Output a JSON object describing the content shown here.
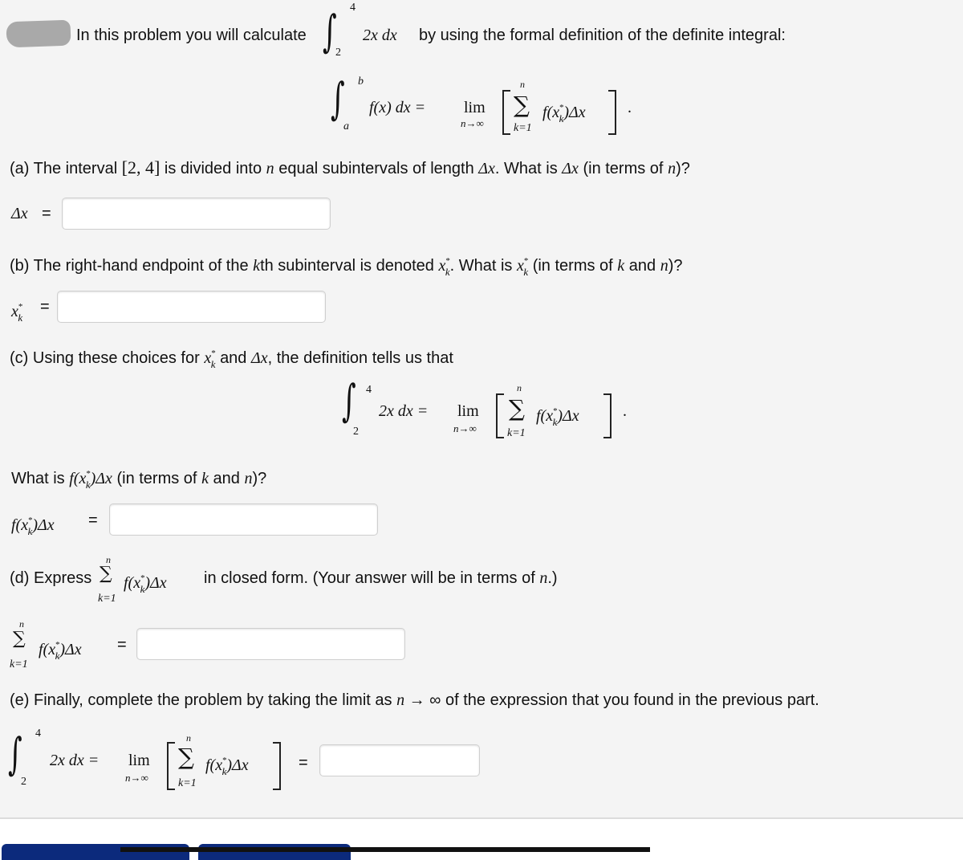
{
  "intro": {
    "prefix": "In this problem you will calculate",
    "integral": {
      "lower": "2",
      "upper": "4",
      "integrand": "2x dx"
    },
    "suffix": "by using the formal definition of the definite integral:"
  },
  "definition": {
    "lower": "a",
    "upper": "b",
    "lhs": "f(x) dx =",
    "lim": "lim",
    "lim_sub": "n→∞",
    "sum_top": "n",
    "sum_bottom": "k=1",
    "sigma": "∑",
    "term": "f(x",
    "term_end": ")Δx",
    "star": "*",
    "k": "k",
    "period": "."
  },
  "part_a": {
    "question_1": "(a) The interval",
    "interval": "[2, 4]",
    "question_2": "is divided into",
    "n": "n",
    "question_3": "equal subintervals of length",
    "dx": "Δx",
    "question_4": ". What is",
    "question_5": "(in terms of",
    "question_6": ")?",
    "label": "Δx",
    "equals": "=",
    "input_value": ""
  },
  "part_b": {
    "q1": "(b) The right-hand endpoint of the",
    "k": "k",
    "q2": "th subinterval is denoted",
    "x": "x",
    "q3": ". What is",
    "q4": "(in terms of",
    "and": "and",
    "n": "n",
    "q5": ")?",
    "equals": "=",
    "input_value": ""
  },
  "part_c": {
    "q1": "(c) Using these choices for",
    "and": "and",
    "dx": "Δx",
    "q2": ", the definition tells us that",
    "integral_lower": "2",
    "integral_upper": "4",
    "integrand": "2x dx =",
    "what_is": "What is",
    "fx": "f(x",
    "fx_end": ")Δx",
    "q3": "(in terms of",
    "q4": "and",
    "q5": ")?",
    "equals": "=",
    "input_value": ""
  },
  "part_d": {
    "q1": "(d) Express",
    "q2": "in closed form. (Your answer will be in terms of",
    "q3": ".)",
    "equals": "=",
    "input_value": ""
  },
  "part_e": {
    "q1": "(e) Finally, complete the problem by taking the limit as",
    "n": "n",
    "arrow": "→ ∞",
    "q2": "of the expression that you found in the previous part.",
    "equals": "=",
    "input_value": ""
  },
  "colors": {
    "panel": "#f4f4f4",
    "button": "#0c2a7c"
  }
}
